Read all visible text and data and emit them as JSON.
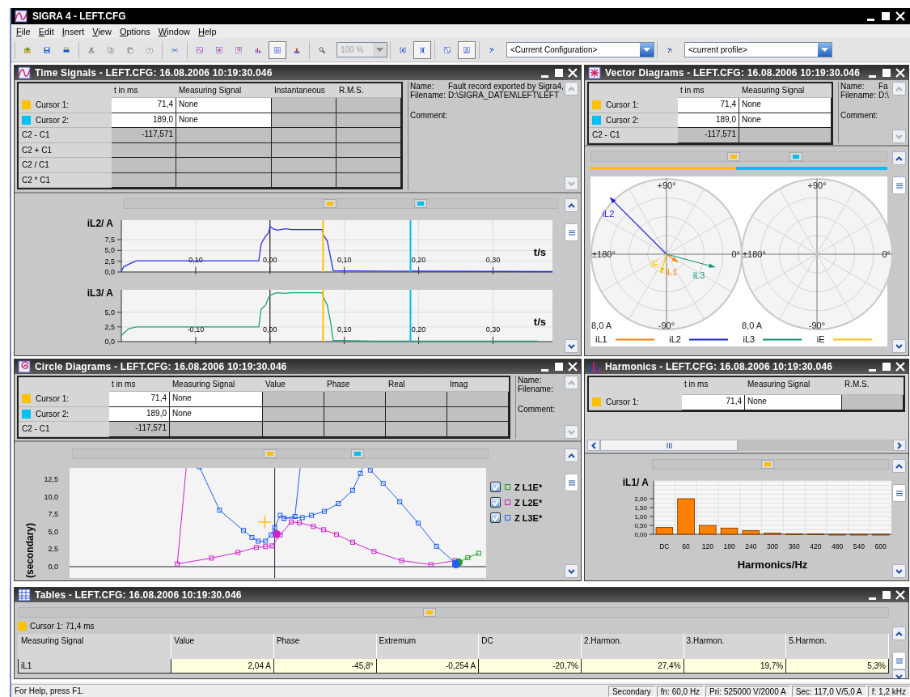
{
  "window": {
    "title": "SIGRA 4 - LEFT.CFG"
  },
  "menu": [
    "File",
    "Edit",
    "Insert",
    "View",
    "Options",
    "Window",
    "Help"
  ],
  "toolbar": [
    {
      "kind": "group",
      "buttons": [
        {
          "kind": "open",
          "pressed": false
        },
        {
          "kind": "save",
          "pressed": false
        },
        {
          "kind": "print",
          "pressed": false
        }
      ]
    },
    {
      "kind": "group",
      "buttons": [
        {
          "kind": "cut",
          "pressed": false
        },
        {
          "kind": "copy",
          "pressed": false
        },
        {
          "kind": "paste",
          "pressed": false
        },
        {
          "kind": "import",
          "pressed": false
        }
      ]
    },
    {
      "kind": "group",
      "buttons": [
        {
          "kind": "cross",
          "pressed": false
        }
      ]
    },
    {
      "kind": "group",
      "buttons": [
        {
          "kind": "time",
          "pressed": false
        },
        {
          "kind": "vector",
          "pressed": false
        },
        {
          "kind": "circle",
          "pressed": false
        },
        {
          "kind": "harmonics",
          "pressed": false
        },
        {
          "kind": "table",
          "pressed": true
        },
        {
          "kind": "locator",
          "pressed": false
        }
      ]
    },
    {
      "kind": "group",
      "buttons": [
        {
          "kind": "search",
          "pressed": false
        }
      ]
    },
    {
      "kind": "combo",
      "value": "100 %",
      "disabled": true
    },
    {
      "kind": "group",
      "buttons": [
        {
          "kind": "cursor-left",
          "pressed": false
        },
        {
          "kind": "cursor-right",
          "pressed": true
        }
      ]
    },
    {
      "kind": "group",
      "buttons": [
        {
          "kind": "sine",
          "pressed": false
        },
        {
          "kind": "step",
          "pressed": true
        }
      ]
    },
    {
      "kind": "group",
      "buttons": [
        {
          "kind": "config",
          "pressed": false
        }
      ]
    },
    {
      "kind": "combo",
      "value": "<Current Configuration>",
      "disabled": false
    },
    {
      "kind": "group",
      "buttons": [
        {
          "kind": "profile",
          "pressed": false
        }
      ]
    },
    {
      "kind": "combo",
      "value": "<current profile>",
      "disabled": false
    }
  ],
  "time_signals": {
    "kind": "time",
    "title": "Time Signals - LEFT.CFG: 16.08.2006 10:19:30.046",
    "grid": {
      "columns": [
        "t in ms",
        "Measuring Signal",
        "Instantaneous",
        "R.M.S."
      ],
      "rows": [
        {
          "kind": "cursor",
          "label": "Cursor 1:",
          "color": "#ffc000",
          "cells": [
            "71,4",
            "None"
          ]
        },
        {
          "kind": "cursor",
          "label": "Cursor 2:",
          "color": "#00bff3",
          "cells": [
            "189,0",
            "None"
          ]
        },
        {
          "kind": "difference",
          "label": "C2 - C1",
          "cells": [
            "-117,571"
          ]
        },
        {
          "kind": "difference",
          "label": "C2 + C1"
        },
        {
          "kind": "difference",
          "label": "C2 / C1"
        },
        {
          "kind": "difference",
          "label": "C2 * C1"
        }
      ]
    },
    "info": [
      {
        "label": "Name:",
        "value": "Fault record exported by Sigra4,"
      },
      {
        "label": "Filename:",
        "value": "D:\\SIGRA_DATEN\\LEFT\\LEFT"
      },
      {
        "label": "Comment:"
      }
    ],
    "plots": [
      {
        "chart_data": {
          "type": "line",
          "ylabel": "iL2/ A",
          "xlabel": "t/s",
          "xlim": [
            -0.2,
            0.38
          ],
          "ylim": [
            0,
            12
          ],
          "xticks": [
            {
              "value": -0.1,
              "label": "0,10"
            },
            {
              "value": 0,
              "label": "0,00"
            },
            {
              "value": 0.1,
              "label": "0,10"
            },
            {
              "value": 0.2,
              "label": "0,20"
            },
            {
              "value": 0.3,
              "label": "0,30"
            }
          ],
          "yticks": [
            {
              "value": 0,
              "label": "0,0"
            },
            {
              "value": 2.5,
              "label": "2,5"
            },
            {
              "value": 5,
              "label": "5,0"
            },
            {
              "value": 7.5,
              "label": "7,5"
            }
          ],
          "x": [
            -0.2,
            -0.197,
            -0.19,
            -0.18,
            -0.015,
            -0.012,
            -0.006,
            -0.002,
            0,
            0.004,
            0.01,
            0.02,
            0.03,
            0.07,
            0.072,
            0.077,
            0.082,
            0.085,
            0.14,
            0.38
          ],
          "ref_lines": [
            {
              "axis": "x",
              "value": 0.0714,
              "color": "#ffc000"
            },
            {
              "axis": "x",
              "value": 0.189,
              "color": "#00bff3"
            }
          ],
          "grid": true,
          "series": [
            {
              "color": "#3030f0",
              "values": [
                0.1,
                1.2,
                1.8,
                2.6,
                2.6,
                6.5,
                8.3,
                9,
                10.6,
                10,
                9.7,
                10,
                9.8,
                9.8,
                8.5,
                7.2,
                3,
                0.3,
                0.2,
                0.1
              ]
            }
          ]
        }
      },
      {
        "chart_data": {
          "type": "line",
          "ylabel": "iL3/ A",
          "xlabel": "t/s",
          "xlim": [
            -0.2,
            0.38
          ],
          "ylim": [
            0,
            8.8
          ],
          "xticks": [
            {
              "value": -0.1,
              "label": "-0,10"
            },
            {
              "value": 0,
              "label": "0,00"
            },
            {
              "value": 0.1,
              "label": "0,10"
            },
            {
              "value": 0.2,
              "label": "0,20"
            },
            {
              "value": 0.3,
              "label": "0,30"
            }
          ],
          "yticks": [
            {
              "value": 0,
              "label": "0,0"
            },
            {
              "value": 2.5,
              "label": "2,5"
            },
            {
              "value": 5,
              "label": "5,0"
            }
          ],
          "x": [
            -0.2,
            -0.197,
            -0.19,
            -0.18,
            -0.015,
            -0.012,
            -0.006,
            -0.002,
            0,
            0.004,
            0.01,
            0.02,
            0.03,
            0.07,
            0.072,
            0.077,
            0.082,
            0.085,
            0.14,
            0.36
          ],
          "ref_lines": [
            {
              "axis": "x",
              "value": 0.0714,
              "color": "#ffc000"
            },
            {
              "axis": "x",
              "value": 0.189,
              "color": "#00bff3"
            }
          ],
          "grid": true,
          "series": [
            {
              "color": "#20a080",
              "values": [
                1,
                1.4,
                2.2,
                2.5,
                2.5,
                5.5,
                6.2,
                7.5,
                7.8,
                8.1,
                8.3,
                8.2,
                8.3,
                8.3,
                7.5,
                6.2,
                3,
                0.2,
                0.1,
                0.1
              ]
            }
          ]
        }
      }
    ]
  },
  "vector_diagrams": {
    "kind": "vector",
    "title": "Vector Diagrams - LEFT.CFG: 16.08.2006 10:19:30.046",
    "grid": {
      "columns": [
        "t in ms",
        "Measuring Signal"
      ],
      "rows": [
        {
          "kind": "cursor",
          "label": "Cursor 1:",
          "color": "#ffc000",
          "cells": [
            "71,4",
            "None"
          ]
        },
        {
          "kind": "cursor",
          "label": "Cursor 2:",
          "color": "#00bff3",
          "cells": [
            "189,0",
            "None"
          ]
        },
        {
          "kind": "difference",
          "label": "C2 - C1",
          "cells": [
            "-117,571"
          ]
        }
      ]
    },
    "info": [
      {
        "label": "Name:",
        "value": "Fa"
      },
      {
        "label": "Filename:",
        "value": "D:\\"
      },
      {
        "label": "Comment:"
      }
    ],
    "polar": {
      "diagrams": [
        {
          "labels": [
            "+90°",
            "-90°",
            "±180°",
            "0°",
            "8,0  A"
          ],
          "vector_labels": [
            "iL1",
            "iL2",
            "iL3",
            "iE"
          ]
        },
        {
          "labels": [
            "+90°",
            "-90°",
            "±180°",
            "0°",
            "8,0  A"
          ]
        }
      ],
      "legend": [
        {
          "name": "iL1",
          "color": "#ff8000"
        },
        {
          "name": "iL2",
          "color": "#2020e0"
        },
        {
          "name": "iL3",
          "color": "#109070"
        },
        {
          "name": "iE",
          "color": "#ffc000"
        }
      ]
    }
  },
  "circle_diagrams": {
    "kind": "circle",
    "title": "Circle Diagrams - LEFT.CFG: 16.08.2006 10:19:30.046",
    "grid": {
      "columns": [
        "t in ms",
        "Measuring Signal",
        "Value",
        "Phase",
        "Real",
        "Imag"
      ],
      "rows": [
        {
          "kind": "cursor",
          "label": "Cursor 1:",
          "color": "#ffc000",
          "cells": [
            "71,4",
            "None"
          ]
        },
        {
          "kind": "cursor",
          "label": "Cursor 2:",
          "color": "#00bff3",
          "cells": [
            "189,0",
            "None"
          ]
        },
        {
          "kind": "difference",
          "label": "C2 - C1",
          "cells": [
            "-117,571"
          ]
        }
      ]
    },
    "info": [
      {
        "label": "Name:"
      },
      {
        "label": "Filename:"
      },
      {
        "label": "Comment:"
      }
    ],
    "plot": {
      "ylabel": "(secondary)",
      "yticks": [
        "12,5",
        "10,0",
        "7,5",
        "5,0",
        "2,5",
        "0,0"
      ],
      "legend": [
        {
          "name": "Z L1E*",
          "color": "#20a020",
          "checked": true
        },
        {
          "name": "Z L2E*",
          "color": "#d020d0",
          "checked": true
        },
        {
          "name": "Z L3E*",
          "color": "#2060f0",
          "checked": true
        }
      ]
    }
  },
  "harmonics": {
    "kind": "harmonics",
    "title": "Harmonics - LEFT.CFG: 16.08.2006 10:19:30.046",
    "grid": {
      "columns": [
        "t in ms",
        "Measuring Signal",
        "R.M.S."
      ],
      "rows": [
        {
          "kind": "cursor",
          "label": "Cursor 1:",
          "color": "#ffc000",
          "cells": [
            "71,4",
            "None"
          ]
        }
      ]
    },
    "chart_data": {
      "type": "bar",
      "ylabel": "iL1/ A",
      "xlabel": "Harmonics/Hz",
      "categories": [
        "DC",
        "60",
        "120",
        "180",
        "240",
        "300",
        "360",
        "420",
        "480",
        "540",
        "600"
      ],
      "ylim": [
        0,
        3
      ],
      "yticks": [
        {
          "value": 0,
          "label": "0,00"
        },
        {
          "value": 0.5,
          "label": "0,50"
        },
        {
          "value": 1,
          "label": "1,00"
        },
        {
          "value": 1.5,
          "label": "1,50"
        },
        {
          "value": 2,
          "label": "2,00"
        }
      ],
      "grid": true,
      "series": [
        {
          "color": "#ff8000",
          "values": [
            0.38,
            2.0,
            0.5,
            0.35,
            0.2,
            0.07,
            0.03,
            0.03,
            0,
            0,
            0
          ]
        }
      ]
    }
  },
  "tables": {
    "kind": "table",
    "title": "Tables - LEFT.CFG: 16.08.2006 10:19:30.046",
    "cursor": {
      "label": "Cursor 1: 71,4 ms",
      "color": "#ffc000"
    },
    "columns": [
      "Measuring Signal",
      "Value",
      "Phase",
      "Extremum",
      "DC",
      "2.Harmon.",
      "3.Harmon.",
      "5.Harmon."
    ],
    "rows": [
      {
        "cells": [
          "iL1",
          "2,04  A",
          "-45,8°",
          "-0,254  A",
          "-20,7%",
          "27,4%",
          "19,7%",
          "5,3%"
        ]
      }
    ]
  },
  "status_bar": {
    "message": "For Help, press F1.",
    "panes": [
      "Secondary",
      "fn: 60,0 Hz",
      "Pri: 525000 V/2000 A",
      "Sec: 117,0 V/5,0 A",
      "f: 1,2 kHz"
    ]
  }
}
